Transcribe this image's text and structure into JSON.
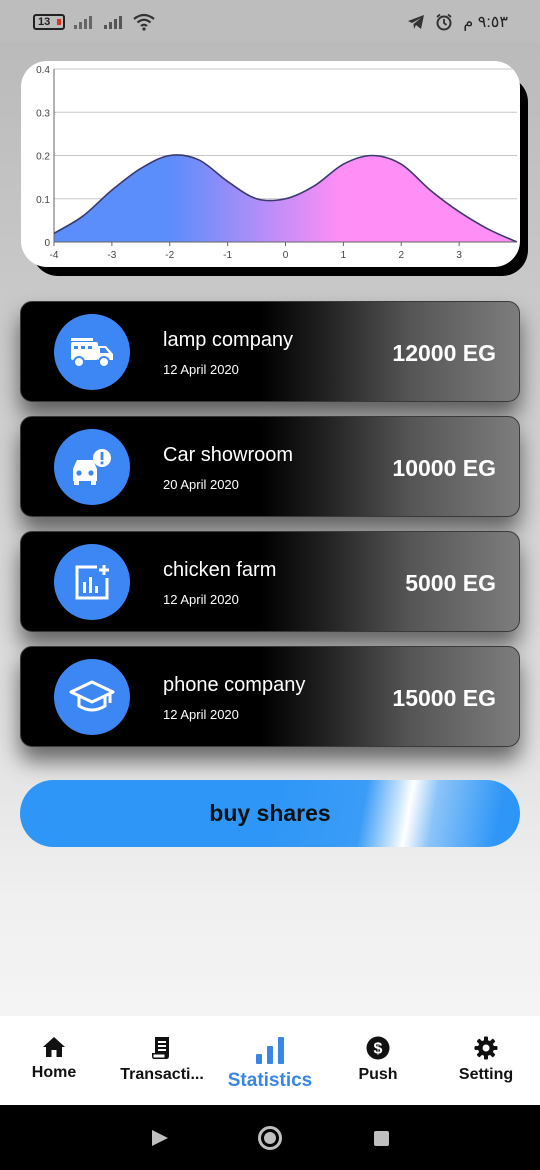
{
  "status_bar": {
    "battery": "13",
    "time": "٩:٥٣ م"
  },
  "chart_data": {
    "type": "area",
    "x_ticks": [
      "-4",
      "-3",
      "-2",
      "-1",
      "0",
      "1",
      "2",
      "3"
    ],
    "y_ticks": [
      "0",
      "0.1",
      "0.2",
      "0.3",
      "0.4"
    ],
    "xlim": [
      -4,
      4
    ],
    "ylim": [
      0,
      0.4
    ],
    "grid": true,
    "x": [
      -4,
      -3.5,
      -3,
      -2.5,
      -2,
      -1.5,
      -1,
      -0.5,
      0,
      0.5,
      1,
      1.5,
      2,
      2.5,
      3,
      3.5,
      4
    ],
    "y": [
      0.02,
      0.06,
      0.12,
      0.17,
      0.2,
      0.19,
      0.14,
      0.1,
      0.1,
      0.13,
      0.18,
      0.2,
      0.18,
      0.12,
      0.07,
      0.03,
      0.0
    ],
    "colors": {
      "start": "#5b8dfb",
      "end": "#ff8ef6",
      "line": "#3a3a6e"
    }
  },
  "investments": [
    {
      "name": "lamp company",
      "date": "12 April 2020",
      "amount": "12000 EG",
      "icon": "fire-truck-icon"
    },
    {
      "name": "Car showroom",
      "date": "20 April 2020",
      "amount": "10000 EG",
      "icon": "car-alert-icon"
    },
    {
      "name": "chicken farm",
      "date": "12 April 2020",
      "amount": "5000 EG",
      "icon": "chart-add-icon"
    },
    {
      "name": "phone company",
      "date": "12 April 2020",
      "amount": "15000 EG",
      "icon": "graduation-cap-icon"
    }
  ],
  "buy_button": {
    "label": "buy shares"
  },
  "bottom_nav": {
    "items": [
      {
        "label": "Home",
        "icon": "home-icon"
      },
      {
        "label": "Transacti...",
        "icon": "receipt-icon"
      },
      {
        "label": "Statistics",
        "icon": "bar-chart-icon",
        "active": true
      },
      {
        "label": "Push",
        "icon": "dollar-icon"
      },
      {
        "label": "Setting",
        "icon": "gear-icon"
      }
    ],
    "active_color": "#3a86e8"
  }
}
